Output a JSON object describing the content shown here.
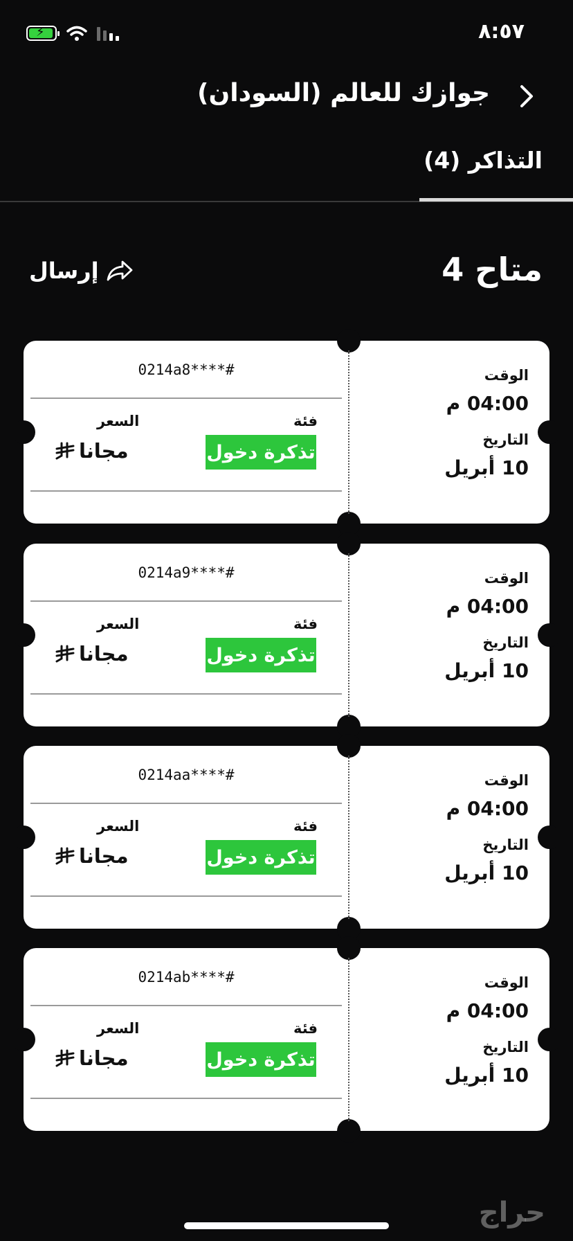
{
  "status_bar": {
    "time": "٨:٥٧"
  },
  "header": {
    "title": "جوازك للعالم (السودان)"
  },
  "tab": {
    "label": "التذاكر (4)"
  },
  "summary": {
    "available": "متاح 4",
    "send_label": "إرسال"
  },
  "ticket_labels": {
    "time": "الوقت",
    "date": "التاريخ",
    "category": "فئة",
    "price": "السعر"
  },
  "tickets": [
    {
      "serial": "0214a8****#",
      "time": "04:00 م",
      "date": "10 أبريل",
      "category": "تذكرة دخول",
      "price": "مجانا"
    },
    {
      "serial": "0214a9****#",
      "time": "04:00 م",
      "date": "10 أبريل",
      "category": "تذكرة دخول",
      "price": "مجانا"
    },
    {
      "serial": "0214aa****#",
      "time": "04:00 م",
      "date": "10 أبريل",
      "category": "تذكرة دخول",
      "price": "مجانا"
    },
    {
      "serial": "0214ab****#",
      "time": "04:00 م",
      "date": "10 أبريل",
      "category": "تذكرة دخول",
      "price": "مجانا"
    }
  ],
  "watermark": "حراج",
  "colors": {
    "background": "#0b0b0c",
    "accent_green": "#2dc63c",
    "ticket_bg": "#ffffff"
  }
}
